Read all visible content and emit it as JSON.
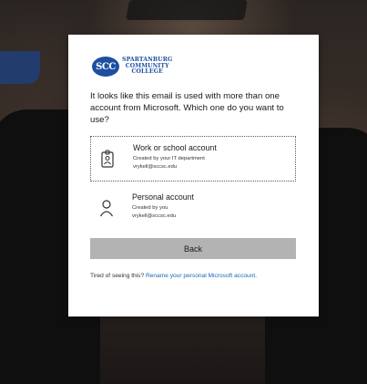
{
  "logo": {
    "badge": "SCC",
    "line1": "SPARTANBURG",
    "line2": "COMMUNITY",
    "line3": "COLLEGE"
  },
  "prompt_text": "It looks like this email is used with more than one account from Microsoft. Which one do you want to use?",
  "accounts": [
    {
      "title": "Work or school account",
      "subtitle": "Created by your IT department",
      "email": "vrykell@sccsc.edu",
      "icon": "badge-icon"
    },
    {
      "title": "Personal account",
      "subtitle": "Created by you",
      "email": "vrykell@sccsc.edu",
      "icon": "person-icon"
    }
  ],
  "back_label": "Back",
  "footer": {
    "text": "Tired of seeing this?",
    "link": "Rename your personal Microsoft account."
  },
  "colors": {
    "accent": "#1d4fa1",
    "link": "#1a64b9",
    "button": "#b3b3b3"
  }
}
